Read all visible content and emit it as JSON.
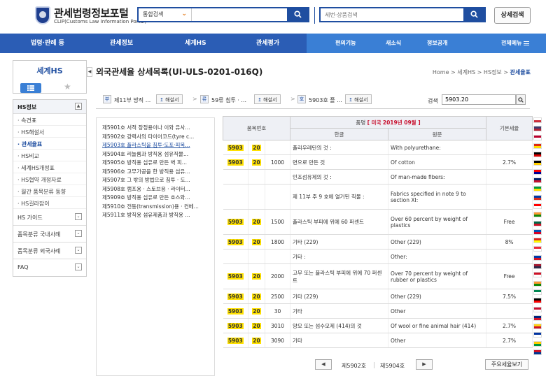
{
  "header": {
    "logo_title": "관세법령정보포털",
    "logo_sub": "CLIP(Customs Law Information Portal)",
    "search1_scope": "통합검색",
    "search2_placeholder": "세번·상품검색",
    "advanced_search_label": "상세검색"
  },
  "nav": {
    "items": [
      "법령·판례 등",
      "관세정보",
      "세계HS",
      "관세평가",
      "편의기능",
      "새소식",
      "정보공개",
      "전체메뉴"
    ]
  },
  "sidebar": {
    "title": "세계HS",
    "section_title": "HS정보",
    "sub_items": [
      "속견표",
      "HS해설서",
      "관세율표",
      "HS비교",
      "세계HS개정표",
      "HS협약 개정자료",
      "월간 품목분류 동향",
      "HS길라잡이"
    ],
    "groups": [
      "HS 가이드",
      "품목분류 국내사례",
      "품목분류 외국사례",
      "FAQ"
    ]
  },
  "main": {
    "title": "외국관세율 상세목록(UI-ULS-0201-016Q)",
    "breadcrumb": [
      "Home",
      "세계HS",
      "HS정보",
      "관세율표"
    ],
    "crumbbar": {
      "tag1": "부",
      "text1": "제11부 방직 ...",
      "btn1": "해설서",
      "tag2": "류",
      "text2": "59류 침투 · ...",
      "btn2": "해설서",
      "tag3": "호",
      "text3": "5903호 플 ...",
      "btn3": "해설서",
      "search_label": "검색",
      "search_value": "5903.20"
    }
  },
  "headings": [
    "제5901호 서적 장정용이나 이와 유사...",
    "제5902호 강력사의 타이어코드(tyre c...",
    "제5903호 플라스틱을 침투·도포·피복...",
    "제5904호 리놀륨과 방직용 섬유직물...",
    "제5905호 방직용 섬유로 만든 벽 피...",
    "제5906호 고무가공을 한 방직용 섬유...",
    "제5907호 그 밖의 방법으로 침투 · 도...",
    "제5908호 램프용 · 스토브용 · 라이터...",
    "제5909호 방직용 섬유로 만든 호스와...",
    "제5910호 전동(transmission)용 · 컨베...",
    "제5911호 방직용 섬유제품과 방직용 ..."
  ],
  "table": {
    "head_code": "품목번호",
    "head_name_prefix": "품명",
    "head_country": "[ 미국",
    "head_date": "2019년 09월 ]",
    "head_korean": "한글",
    "head_original": "원문",
    "head_rate": "기본세율",
    "rows": [
      {
        "h": "5903",
        "s": "20",
        "d": "",
        "ko": "폴리우레탄의 것 :",
        "en": "With polyurethane:",
        "rate": ""
      },
      {
        "h": "5903",
        "s": "20",
        "d": "1000",
        "ko": "면으로 만든 것",
        "en": "Of cotton",
        "rate": "2.7%"
      },
      {
        "h": "",
        "s": "",
        "d": "",
        "ko": "인조섬유제의 것 :",
        "en": "Of man-made fibers:",
        "rate": ""
      },
      {
        "h": "",
        "s": "",
        "d": "",
        "ko": "제 11부 주 9 호에 열거된 직물 :",
        "en": "Fabrics specified in note 9 to section XI:",
        "rate": "",
        "tall": true
      },
      {
        "h": "5903",
        "s": "20",
        "d": "1500",
        "ko": "플라스틱 부피에 위에 60 퍼센트",
        "en": "Over 60 percent by weight of plastics",
        "rate": "Free",
        "tall": true
      },
      {
        "h": "5903",
        "s": "20",
        "d": "1800",
        "ko": "기타 (229)",
        "en": "Other (229)",
        "rate": "8%"
      },
      {
        "h": "",
        "s": "",
        "d": "",
        "ko": "기타 :",
        "en": "Other:",
        "rate": ""
      },
      {
        "h": "5903",
        "s": "20",
        "d": "2000",
        "ko": "고무 또는 플라스틱 부피에 위에 70 퍼센트",
        "en": "Over 70 percent by weight of rubber or plastics",
        "rate": "Free",
        "tall": true
      },
      {
        "h": "5903",
        "s": "20",
        "d": "2500",
        "ko": "기타 (229)",
        "en": "Other (229)",
        "rate": "7.5%"
      },
      {
        "h": "5903",
        "s": "20",
        "d": "30",
        "ko": "기타",
        "en": "Other",
        "rate": ""
      },
      {
        "h": "5903",
        "s": "20",
        "d": "3010",
        "ko": "양모 또는 섬수모제 (414)의 것",
        "en": "Of wool or fine animal hair (414)",
        "rate": "2.7%"
      },
      {
        "h": "5903",
        "s": "20",
        "d": "3090",
        "ko": "기타",
        "en": "Other",
        "rate": "2.7%"
      }
    ]
  },
  "pager": {
    "prev_label": "제5902호",
    "next_label": "제5904호",
    "rates_button": "주요세율보기"
  },
  "colors": {
    "brand_blue": "#1f4ea0",
    "nav_blue": "#2b5db5",
    "nav_light": "#3a7fd5",
    "highlight": "#ffe100"
  },
  "flags": [
    [
      "#ffffff",
      "#cd2e3a"
    ],
    [
      "#3c3b6e",
      "#b22234"
    ],
    [
      "#bc002d",
      "#ffffff"
    ],
    [
      "#de2910",
      "#ffde00"
    ],
    [
      "#000000",
      "#dd0000"
    ],
    [
      "#000000",
      "#ffce00"
    ],
    [
      "#fe0000",
      "#000095"
    ],
    [
      "#012169",
      "#c8102e"
    ],
    [
      "#009c3b",
      "#ffdf00"
    ],
    [
      "#0039a6",
      "#d52b1e"
    ],
    [
      "#ff0000",
      "#ffffff"
    ],
    [
      "#ff9933",
      "#138808"
    ],
    [
      "#006847",
      "#ce1126"
    ],
    [
      "#0052b4",
      "#d80027"
    ],
    [
      "#da251d",
      "#ffff00"
    ],
    [
      "#ed2939",
      "#ffffff"
    ],
    [
      "#0038a8",
      "#ce1126"
    ],
    [
      "#a51931",
      "#2d2a4a"
    ],
    [
      "#ce1126",
      "#ffffff"
    ],
    [
      "#ff9933",
      "#128807"
    ],
    [
      "#008751",
      "#ffffff"
    ],
    [
      "#000000",
      "#ff0000"
    ],
    [
      "#c8102e",
      "#ffffff"
    ],
    [
      "#00247d",
      "#cf142b"
    ],
    [
      "#fcd116",
      "#ce1126"
    ],
    [
      "#0033a0",
      "#ffffff"
    ],
    [
      "#ffcc00",
      "#009739"
    ],
    [
      "#ce1126",
      "#003893"
    ]
  ]
}
